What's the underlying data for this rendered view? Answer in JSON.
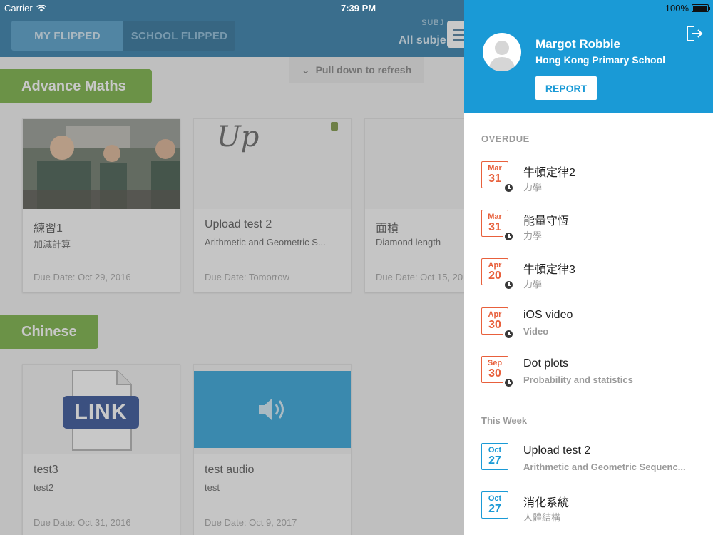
{
  "status_bar": {
    "carrier": "Carrier",
    "time": "7:39 PM",
    "battery": "100%"
  },
  "header": {
    "tabs": [
      {
        "label": "MY FLIPPED"
      },
      {
        "label": "SCHOOL FLIPPED"
      }
    ],
    "subject_label": "SUBJ",
    "subject_value": "All subje"
  },
  "pull_refresh": "Pull down to refresh",
  "sections": [
    {
      "title": "Advance Maths",
      "cards": [
        {
          "title": "練習1",
          "subtitle": "加減計算",
          "due": "Due Date: Oct 29, 2016"
        },
        {
          "title": "Upload test 2",
          "subtitle": "Arithmetic and Geometric S...",
          "due": "Due Date: Tomorrow",
          "sketch": "Up"
        },
        {
          "title": "面積",
          "subtitle": "Diamond length",
          "due": "Due Date: Oct 15, 20"
        }
      ]
    },
    {
      "title": "Chinese",
      "cards": [
        {
          "title": "test3",
          "subtitle": "test2",
          "due": "Due Date: Oct 31, 2016",
          "link_text": "LINK"
        },
        {
          "title": "test audio",
          "subtitle": "test",
          "due": "Due Date: Oct 9, 2017"
        }
      ]
    }
  ],
  "drawer": {
    "user_name": "Margot Robbie",
    "school": "Hong Kong Primary School",
    "report_label": "REPORT",
    "groups": [
      {
        "label": "OVERDUE",
        "items": [
          {
            "month": "Mar",
            "day": "31",
            "title": "牛頓定律2",
            "subtitle": "力學"
          },
          {
            "month": "Mar",
            "day": "31",
            "title": "能量守恆",
            "subtitle": "力學"
          },
          {
            "month": "Apr",
            "day": "20",
            "title": "牛頓定律3",
            "subtitle": "力學"
          },
          {
            "month": "Apr",
            "day": "30",
            "title": "iOS video",
            "subtitle": "Video"
          },
          {
            "month": "Sep",
            "day": "30",
            "title": "Dot plots",
            "subtitle": "Probability and statistics"
          }
        ]
      },
      {
        "label": "This Week",
        "items": [
          {
            "month": "Oct",
            "day": "27",
            "title": "Upload test 2",
            "subtitle": "Arithmetic and Geometric Sequenc..."
          },
          {
            "month": "Oct",
            "day": "27",
            "title": "消化系統",
            "subtitle": "人體結構"
          }
        ]
      }
    ]
  },
  "colors": {
    "overdue": "#e8603c",
    "this_week": "#1a9ad6",
    "drawer_header": "#1a9ad6",
    "section_tag": "#6aa82f",
    "topbar": "#1a6ea0"
  }
}
